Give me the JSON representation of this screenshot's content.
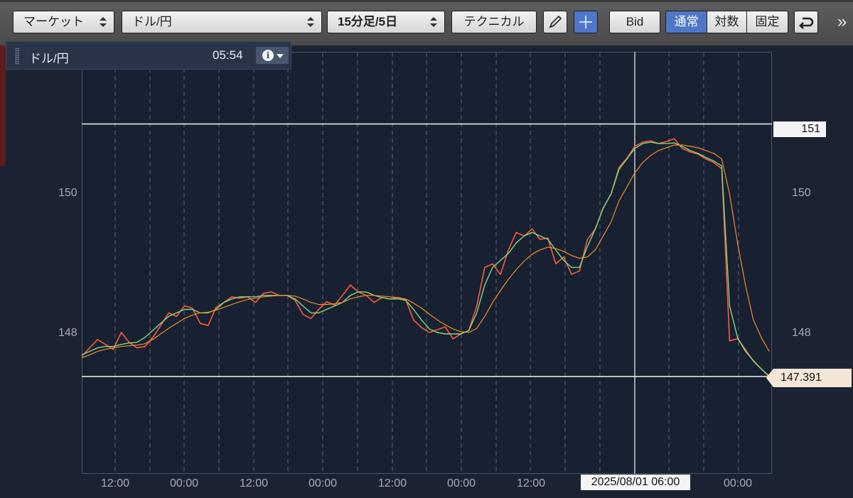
{
  "toolbar": {
    "market_select": "マーケット",
    "pair_select": "ドル/円",
    "period_select": "15分足/5日",
    "technical_button": "テクニカル",
    "bid_button": "Bid",
    "scale_modes": [
      "通常",
      "対数",
      "固定"
    ],
    "active_scale_mode": "通常",
    "more_label": "»"
  },
  "info_panel": {
    "title": "ドル/円",
    "time": "05:54"
  },
  "chart_data": {
    "type": "line",
    "title": "",
    "xlabel": "",
    "ylabel": "",
    "x_tick_labels": [
      "12:00",
      "00:00",
      "12:00",
      "00:00",
      "12:00",
      "00:00",
      "12:00",
      "00:00"
    ],
    "y_tick_labels": [
      "150",
      "148"
    ],
    "ylim": [
      146.4,
      152.0
    ],
    "horizontal_lines": [
      151,
      147.391
    ],
    "crosshair_label": "2025/08/01 06:00",
    "last_price": "147.391",
    "grid": true,
    "series": [
      {
        "values": [
          147.68,
          147.8,
          147.92,
          147.85,
          147.78,
          148.02,
          147.88,
          147.8,
          147.82,
          147.95,
          148.12,
          148.3,
          148.25,
          148.4,
          148.37,
          148.15,
          148.12,
          148.38,
          148.45,
          148.53,
          148.51,
          148.53,
          148.45,
          148.58,
          148.6,
          148.55,
          148.55,
          148.48,
          148.28,
          148.22,
          148.35,
          148.46,
          148.41,
          148.55,
          148.7,
          148.6,
          148.55,
          148.45,
          148.52,
          148.5,
          148.52,
          148.49,
          148.2,
          148.09,
          148.02,
          148.06,
          148.1,
          147.93,
          148.0,
          148.05,
          148.4,
          148.95,
          149.0,
          148.85,
          149.2,
          149.45,
          149.4,
          149.5,
          149.35,
          149.37,
          149.0,
          149.1,
          148.85,
          148.9,
          149.35,
          149.5,
          149.8,
          150.0,
          150.38,
          150.51,
          150.68,
          150.74,
          150.76,
          150.72,
          150.75,
          150.79,
          150.65,
          150.6,
          150.57,
          150.5,
          150.45,
          150.36,
          147.9,
          147.93,
          147.78,
          147.61,
          147.5,
          147.39
        ]
      },
      {
        "values": [
          147.7,
          147.75,
          147.8,
          147.82,
          147.82,
          147.85,
          147.87,
          147.88,
          147.95,
          148.05,
          148.15,
          148.25,
          148.3,
          148.35,
          148.35,
          148.3,
          148.3,
          148.35,
          148.45,
          148.5,
          148.53,
          148.53,
          148.53,
          148.55,
          148.55,
          148.55,
          148.55,
          148.5,
          148.4,
          148.3,
          148.3,
          148.35,
          148.4,
          148.45,
          148.55,
          148.6,
          148.6,
          148.55,
          148.52,
          148.5,
          148.5,
          148.48,
          148.35,
          148.2,
          148.07,
          148.02,
          148.0,
          148.0,
          148.0,
          148.05,
          148.3,
          148.7,
          148.95,
          149.05,
          149.15,
          149.3,
          149.4,
          149.45,
          149.4,
          149.35,
          149.2,
          149.05,
          148.95,
          148.95,
          149.25,
          149.5,
          149.8,
          150.0,
          150.35,
          150.5,
          150.65,
          150.72,
          150.74,
          150.72,
          150.72,
          150.73,
          150.68,
          150.62,
          150.58,
          150.52,
          150.47,
          150.4,
          148.4,
          147.95,
          147.75,
          147.62,
          147.5,
          147.4
        ]
      },
      {
        "values": [
          147.66,
          147.7,
          147.75,
          147.78,
          147.8,
          147.82,
          147.83,
          147.84,
          147.86,
          147.92,
          148.0,
          148.08,
          148.15,
          148.22,
          148.27,
          148.3,
          148.31,
          148.34,
          148.38,
          148.42,
          148.46,
          148.49,
          148.51,
          148.53,
          148.54,
          148.55,
          148.55,
          148.54,
          148.5,
          148.45,
          148.42,
          148.42,
          148.43,
          148.45,
          148.5,
          148.53,
          148.55,
          148.55,
          148.54,
          148.53,
          148.52,
          148.5,
          148.44,
          148.37,
          148.28,
          148.2,
          148.13,
          148.07,
          148.03,
          148.02,
          148.08,
          148.25,
          148.45,
          148.62,
          148.78,
          148.92,
          149.04,
          149.14,
          149.2,
          149.24,
          149.22,
          149.18,
          149.12,
          149.08,
          149.1,
          149.2,
          149.4,
          149.6,
          149.9,
          150.1,
          150.3,
          150.45,
          150.55,
          150.62,
          150.66,
          150.7,
          150.7,
          150.68,
          150.66,
          150.62,
          150.58,
          150.5,
          150.0,
          149.3,
          148.7,
          148.2,
          147.95,
          147.75
        ]
      }
    ],
    "series_colors": [
      "#ff5a3c",
      "#7fd97f",
      "#f28c28"
    ]
  }
}
